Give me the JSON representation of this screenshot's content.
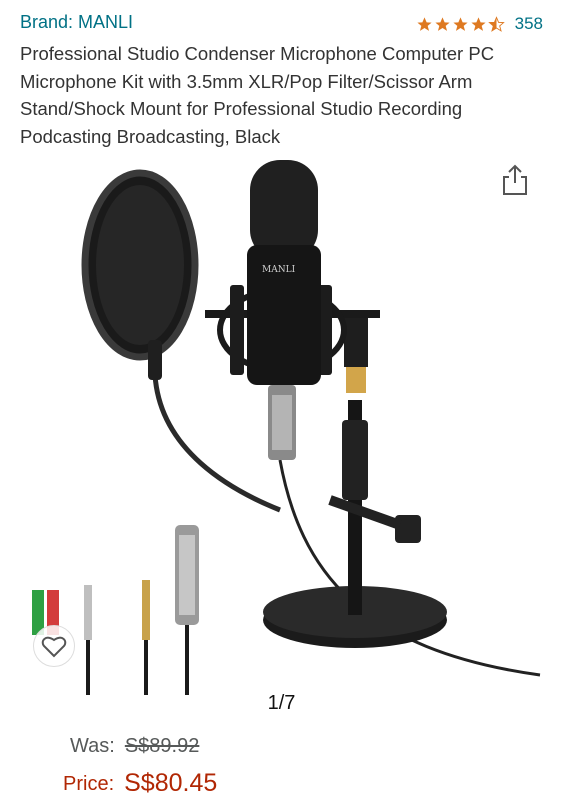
{
  "header": {
    "brand": "Brand: MANLI",
    "rating_value": 4.5,
    "review_count": "358"
  },
  "product": {
    "title": "Professional Studio Condenser Microphone Computer PC Microphone Kit with 3.5mm XLR/Pop Filter/Scissor Arm Stand/Shock Mount for Professional Studio Recording Podcasting Broadcasting, Black",
    "mic_logo": "MANLI"
  },
  "gallery": {
    "pager": "1/7"
  },
  "pricing": {
    "was_label": "Was:",
    "was_value": "S$89.92",
    "price_label": "Price:",
    "price_value": "S$80.45"
  },
  "colors": {
    "link": "#007185",
    "star": "#de7921",
    "price": "#b12704"
  },
  "icons": [
    "star-icon",
    "share-icon",
    "heart-icon"
  ]
}
